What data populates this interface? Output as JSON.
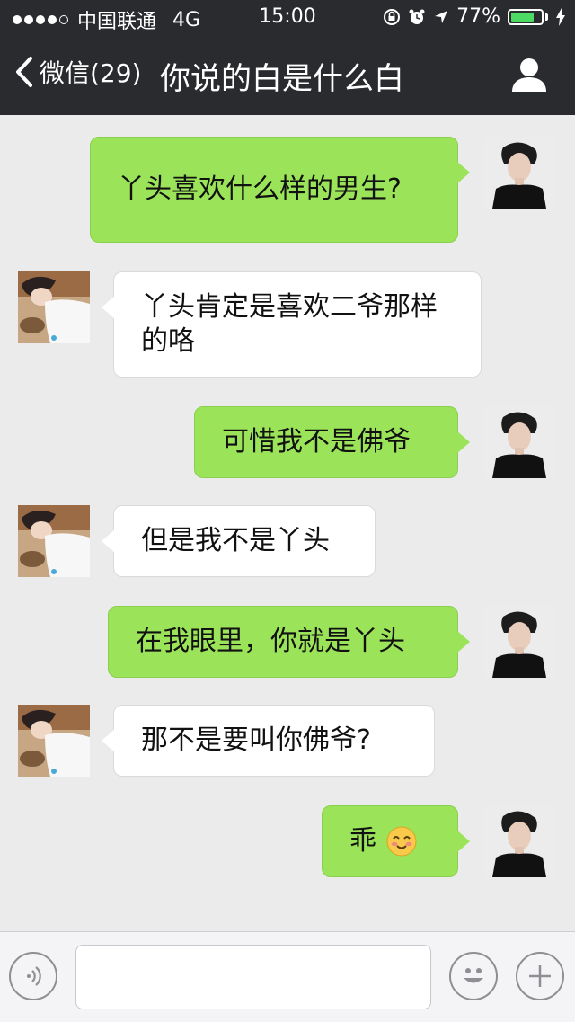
{
  "status_bar": {
    "carrier": "中国联通",
    "network": "4G",
    "time": "15:00",
    "battery_percent_label": "77%",
    "battery_level": 0.77,
    "signal_bars_filled": 4,
    "signal_bars_total": 5
  },
  "nav": {
    "back_label": "微信(29)",
    "title": "你说的白是什么白"
  },
  "messages": [
    {
      "sender": "me",
      "text": "丫头喜欢什么样的男生?"
    },
    {
      "sender": "other",
      "text": "丫头肯定是喜欢二爷那样的咯"
    },
    {
      "sender": "me",
      "text": "可惜我不是佛爷"
    },
    {
      "sender": "other",
      "text": "但是我不是丫头"
    },
    {
      "sender": "me",
      "text": "在我眼里，你就是丫头"
    },
    {
      "sender": "other",
      "text": "那不是要叫你佛爷?"
    },
    {
      "sender": "me",
      "text": "乖",
      "emoji": "blushing-smile-emoji"
    }
  ],
  "input": {
    "placeholder": ""
  },
  "colors": {
    "bar_bg": "#2a2b2f",
    "chat_bg": "#ebebeb",
    "my_bubble": "#9be45a",
    "other_bubble": "#ffffff",
    "battery": "#4cd964"
  }
}
